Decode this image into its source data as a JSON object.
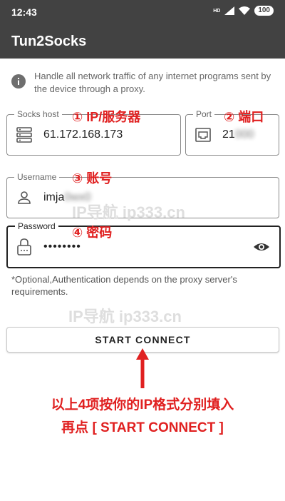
{
  "status_bar": {
    "time": "12:43",
    "signal": "HD",
    "battery": "100"
  },
  "app_bar": {
    "title": "Tun2Socks"
  },
  "info": {
    "text": "Handle all network traffic of any internet programs sent by the device through a proxy.",
    "icon": "info-icon"
  },
  "fields": {
    "socks_host": {
      "label": "Socks host",
      "value": "61.172.168.173",
      "icon": "server-icon"
    },
    "port": {
      "label": "Port",
      "value": "21",
      "value_blurred": "000",
      "icon": "ethernet-port-icon"
    },
    "username": {
      "label": "Username",
      "value": "imja",
      "value_blurred": "0wx0",
      "icon": "person-icon"
    },
    "password": {
      "label": "Password",
      "value": "••••••••",
      "icon": "lock-icon",
      "toggle_icon": "eye-icon"
    }
  },
  "hint": "*Optional,Authentication depends on the proxy server's requirements.",
  "start_button": {
    "label": "START CONNECT"
  },
  "annotations": {
    "host": "① IP/服务器",
    "port": "② 端口",
    "username": "③ 账号",
    "password": "④ 密码",
    "instruction_line1": "以上4项按你的IP格式分别填入",
    "instruction_line2": "再点 [ START CONNECT ]"
  },
  "watermark": {
    "text": "IP导航  ip333.cn"
  },
  "colors": {
    "appbar": "#424242",
    "annotation": "#e02020",
    "field_border": "#8a8a8a"
  }
}
